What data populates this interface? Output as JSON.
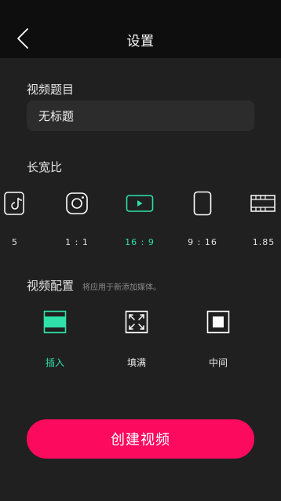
{
  "header": {
    "title": "设置"
  },
  "video_title": {
    "label": "视频题目",
    "value": "无标题"
  },
  "aspect_ratio": {
    "label": "长宽比",
    "options": [
      {
        "label": "5",
        "icon": "tiktok-icon"
      },
      {
        "label": "1 : 1",
        "icon": "instagram-icon"
      },
      {
        "label": "16 : 9",
        "icon": "youtube-icon",
        "selected": true
      },
      {
        "label": "9 : 16",
        "icon": "portrait-phone-icon"
      },
      {
        "label": "1.85",
        "icon": "film-icon"
      }
    ]
  },
  "video_config": {
    "label": "视频配置",
    "hint": "将应用于新添加媒体。",
    "options": [
      {
        "label": "插入",
        "icon": "fit-icon",
        "selected": true
      },
      {
        "label": "填满",
        "icon": "fill-expand-icon"
      },
      {
        "label": "中间",
        "icon": "center-icon"
      }
    ]
  },
  "create_button": {
    "label": "创建视频"
  },
  "colors": {
    "accent": "#2fe0a8",
    "primary_button": "#fb0a5d",
    "background": "#202020",
    "header": "#0e0e0e"
  }
}
